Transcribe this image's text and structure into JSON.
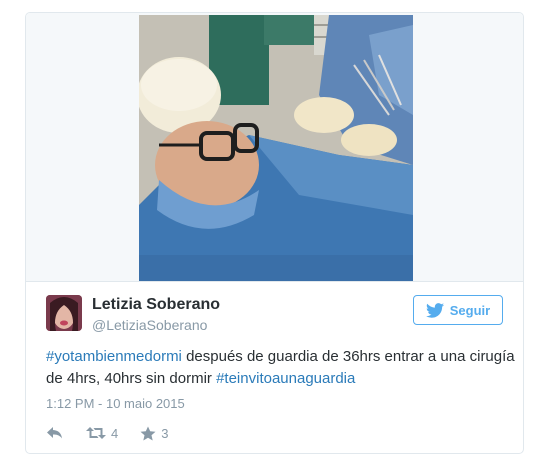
{
  "tweet": {
    "author_name": "Letizia Soberano",
    "author_handle": "@LetiziaSoberano",
    "follow_label": "Seguir",
    "text_parts": [
      {
        "type": "hashtag",
        "text": "#yotambienmedormi"
      },
      {
        "type": "text",
        "text": " después de guardia de 36hrs entrar a una cirugía de 4hrs, 40hrs sin dormir  "
      },
      {
        "type": "hashtag",
        "text": "#teinvitoaunaguardia"
      }
    ],
    "timestamp": "1:12 PM - 10 maio 2015",
    "retweet_count": "4",
    "like_count": "3"
  },
  "icons": {
    "reply": "reply-icon",
    "retweet": "retweet-icon",
    "like": "star-icon",
    "follow": "twitter-bird-icon"
  },
  "colors": {
    "link": "#2b7bb9",
    "follow_accent": "#55acee",
    "meta": "#8899a6",
    "text": "#292f33"
  }
}
